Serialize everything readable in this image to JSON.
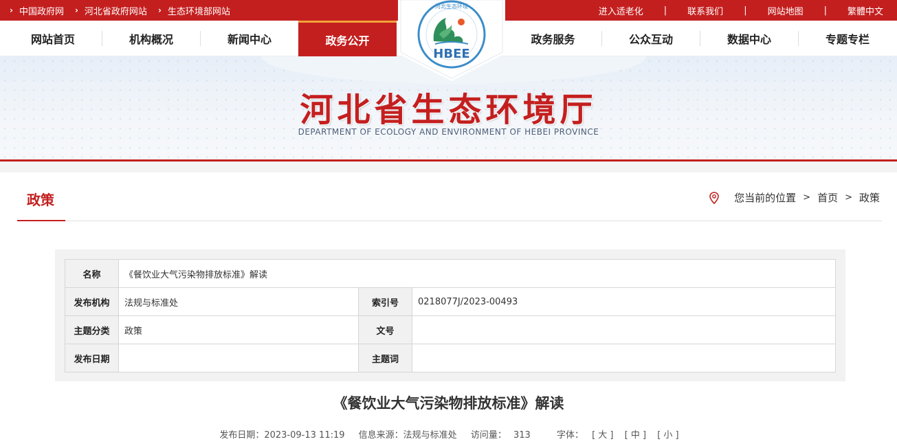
{
  "topbar": {
    "left_links": [
      "中国政府网",
      "河北省政府网站",
      "生态环境部网站"
    ],
    "right_links": [
      "进入适老化",
      "联系我们",
      "网站地图",
      "繁體中文"
    ],
    "separator": "|"
  },
  "nav": {
    "left": [
      "网站首页",
      "机构概况",
      "新闻中心",
      "政务公开"
    ],
    "right": [
      "政务服务",
      "公众互动",
      "数据中心",
      "专题专栏"
    ],
    "active": "政务公开"
  },
  "logo": {
    "text": "HBEE",
    "ring_text": "河北生态环境"
  },
  "banner": {
    "title": "河北省生态环境厅",
    "subtitle": "DEPARTMENT OF ECOLOGY AND ENVIRONMENT OF HEBEI PROVINCE"
  },
  "section": {
    "title": "政策"
  },
  "breadcrumb": {
    "prefix": "您当前的位置",
    "items": [
      "首页",
      "政策"
    ],
    "sep": ">"
  },
  "meta": {
    "name_label": "名称",
    "name_value": "《餐饮业大气污染物排放标准》解读",
    "org_label": "发布机构",
    "org_value": "法规与标准处",
    "index_label": "索引号",
    "index_value": "0218077J/2023-00493",
    "topic_label": "主题分类",
    "topic_value": "政策",
    "docno_label": "文号",
    "docno_value": "",
    "date_label": "发布日期",
    "date_value": "",
    "keyword_label": "主题词",
    "keyword_value": ""
  },
  "article": {
    "title": "《餐饮业大气污染物排放标准》解读",
    "date": "发布日期：2023-09-13 11:19",
    "source": "信息来源：法规与标准处",
    "views_label": "访问量：",
    "views": "313",
    "font_label": "字体：",
    "font_large": "[ 大 ]",
    "font_medium": "[ 中 ]",
    "font_small": "[ 小 ]"
  },
  "colors": {
    "brand_red": "#c41f1f",
    "accent_orange": "#f2a23a"
  }
}
